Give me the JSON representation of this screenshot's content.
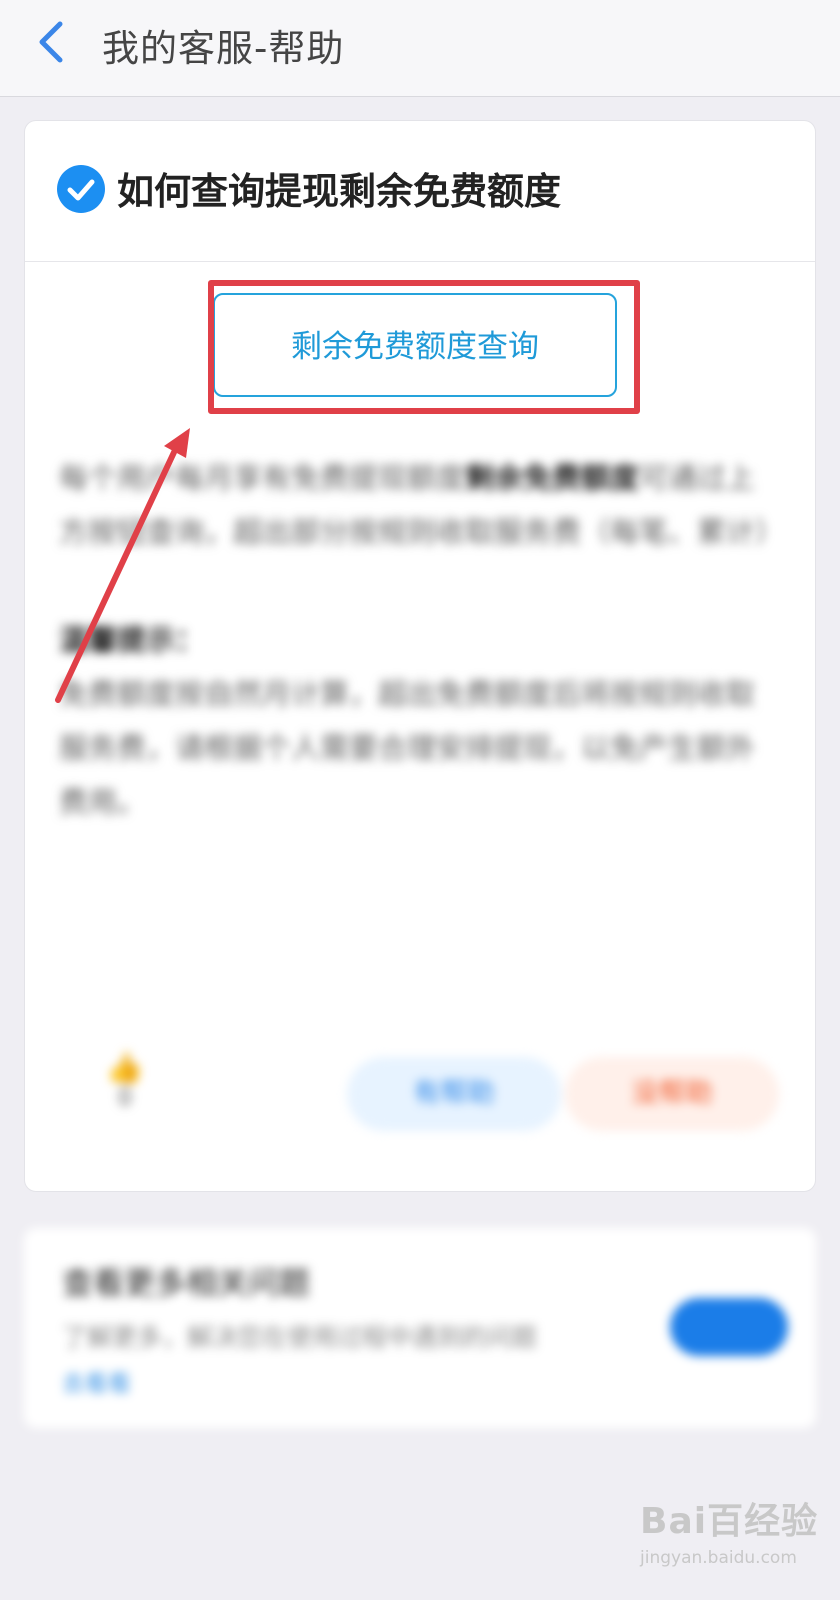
{
  "header": {
    "title": "我的客服-帮助",
    "back_icon": "chevron-left-icon"
  },
  "question": {
    "title": "如何查询提现剩余免费额度",
    "icon": "check-circle-icon",
    "query_button": "剩余免费额度查询"
  },
  "answer": {
    "paragraph1_start": "每个用户每月享有免费提现额度",
    "paragraph1_bold": "剩余免费额度",
    "paragraph1_end": "可通过上方按钮查询，超出部分按规则收取服务费（每笔、累计）",
    "tip_label": "温馨提示：",
    "tip_text": "免费额度按自然月计算，超出免费额度后将按规则收取服务费，请根据个人需要合理安排提现，以免产生额外费用。"
  },
  "feedback": {
    "like_label": "0",
    "useful_label": "有帮助",
    "useless_label": "没帮助"
  },
  "promo": {
    "title": "查看更多相关问题",
    "desc": "了解更多，解决您在使用过程中遇到的问题",
    "link": "去看看"
  },
  "watermark": {
    "logo": "Bai百经验",
    "url": "jingyan.baidu.com"
  },
  "colors": {
    "accent": "#1c8ff2",
    "highlight": "#e04048"
  }
}
